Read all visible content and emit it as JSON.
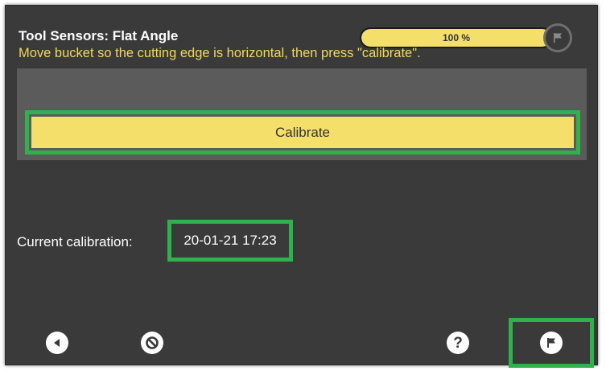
{
  "header": {
    "title": "Tool Sensors: Flat Angle",
    "progress": {
      "value": 1.0,
      "label": "100 %",
      "icon": "flag-icon"
    }
  },
  "panel": {
    "instruction": "Move bucket so the cutting edge is horizontal, then press \"calibrate\".",
    "calibrate_label": "Calibrate"
  },
  "calibration": {
    "label": "Current calibration:",
    "value": "20-01-21 17:23"
  },
  "toolbar": {
    "back_icon": "back-arrow-icon",
    "cancel_icon": "cancel-icon",
    "help_icon": "help-icon",
    "finish_icon": "flag-icon"
  },
  "colors": {
    "background": "#3a3a3a",
    "panel": "#5b5b5b",
    "accent_yellow": "#f4df6a",
    "instruction_text": "#f1d85a",
    "highlight_green": "#2fb14c"
  }
}
